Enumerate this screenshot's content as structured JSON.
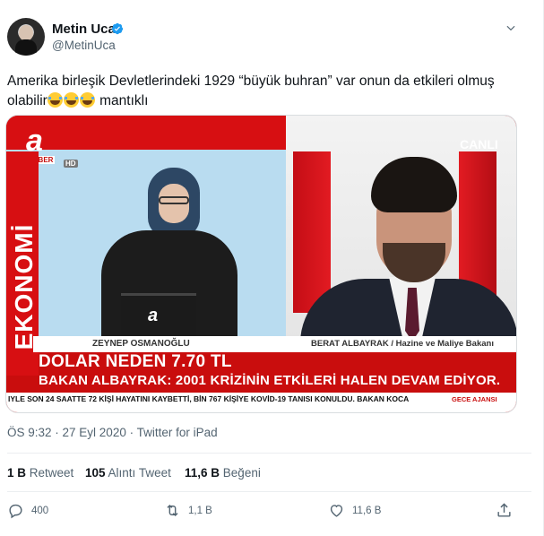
{
  "author": {
    "display_name": "Metin Uca",
    "handle": "@MetinUca",
    "verified": true,
    "avatar_icon": "user-avatar"
  },
  "tweet": {
    "text_line1": "Amerika birleşik Devletlerindeki 1929 “büyük buhran” var onun da etkileri olmuş",
    "text_line2_before": "olabilir",
    "emoji_count": 3,
    "emoji_name": "face-with-tears-of-joy",
    "text_line2_after": " mantıklı",
    "timestamp": "ÖS 9:32 · 27 Eyl 2020 · Twitter for iPad"
  },
  "media": {
    "channel_logo": "a",
    "channel_tag": "HABER",
    "hd_tag": "HD",
    "side_label": "EKONOMİ",
    "live_badge": "CANLI",
    "laptop_logo": "a",
    "caption_left": "ZEYNEP OSMANOĞLU",
    "caption_right": "BERAT ALBAYRAK / Hazine ve Maliye Bakanı",
    "headline_1": "DOLAR NEDEN 7.70 TL",
    "headline_2": "BAKAN ALBAYRAK: 2001 KRİZİNİN ETKİLERİ HALEN DEVAM EDİYOR.",
    "ticker": "IYLE SON 24 SAATTE 72 KİŞİ HAYATINI KAYBETTİ, BİN 767 KİŞİYE KOVİD-19 TANISI KONULDU. BAKAN KOCA",
    "ticker_tag": "GECE AJANSI"
  },
  "stats": {
    "retweets_num": "1 B",
    "retweets_label": "Retweet",
    "quotes_num": "105",
    "quotes_label": "Alıntı Tweet",
    "likes_num": "11,6 B",
    "likes_label": "Beğeni"
  },
  "actions": {
    "reply_count": "400",
    "retweet_count": "1,1 B",
    "like_count": "11,6 B",
    "share_count": ""
  },
  "colors": {
    "accent": "#1d9bf0",
    "text": "#0f1419",
    "muted": "#536471",
    "channel_red": "#c90d0d"
  }
}
